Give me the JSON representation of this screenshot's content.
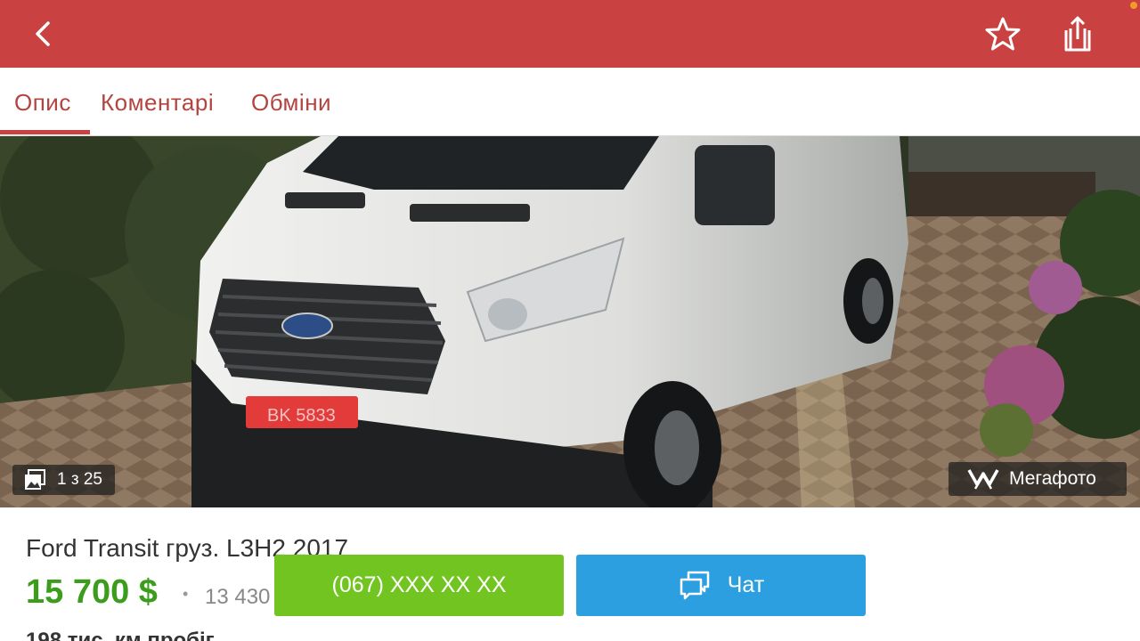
{
  "header": {
    "back_icon": "chevron-left-icon",
    "favorite_icon": "star-outline-icon",
    "share_icon": "share-icon",
    "bar_color": "#c94241"
  },
  "tabs": [
    {
      "label": "Опис",
      "active": true
    },
    {
      "label": "Коментарі",
      "active": false
    },
    {
      "label": "Обміни",
      "active": false
    }
  ],
  "photo": {
    "counter": "1 з 25",
    "badge": "Мегафото",
    "plate": "BK 5833"
  },
  "listing": {
    "title": "Ford Transit груз. L3H2 2017",
    "price": "15 700 $",
    "separator": "•",
    "price_alt": "13 430",
    "mileage": "198 тис. км пробіг"
  },
  "actions": {
    "phone": "(067) XXX XX XX",
    "chat": "Чат",
    "phone_color": "#72c521",
    "chat_color": "#2b9fe0"
  }
}
